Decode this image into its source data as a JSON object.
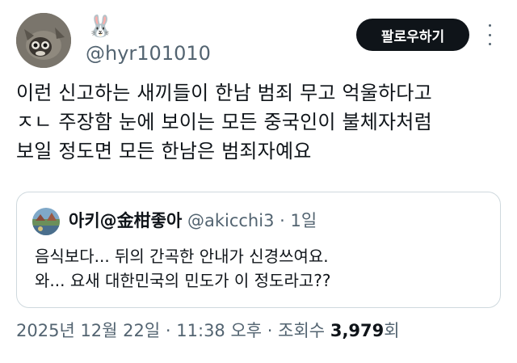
{
  "author": {
    "display_name": "🐰",
    "handle": "@hyr101010"
  },
  "follow_button": {
    "label": "팔로우하기"
  },
  "more_button": {
    "icon": "more-vertical-icon"
  },
  "tweet": {
    "lines": [
      "이런 신고하는 새끼들이 한남 범죄 무고 억울하다고",
      "ㅈㄴ 주장함 눈에 보이는 모든 중국인이 불체자처럼",
      "보일 정도면 모든 한남은 범죄자예요"
    ]
  },
  "quote": {
    "name": "아키@金柑좋아",
    "handle": "@akicchi3",
    "separator": "·",
    "time": "1일",
    "lines": [
      "음식보다... 뒤의 간곡한 안내가 신경쓰여요.",
      "와... 요새 대한민국의 민도가 이 정도라고??"
    ]
  },
  "meta": {
    "date": "2025년 12월 22일",
    "sep1": "·",
    "time": "11:38 오후",
    "sep2": "·",
    "views_label": "조회수",
    "views_count": "3,979",
    "views_suffix": "회"
  },
  "colors": {
    "text": "#0f1419",
    "secondary": "#536471",
    "border": "#cfd9de",
    "button_bg": "#0f1419",
    "button_text": "#ffffff"
  }
}
